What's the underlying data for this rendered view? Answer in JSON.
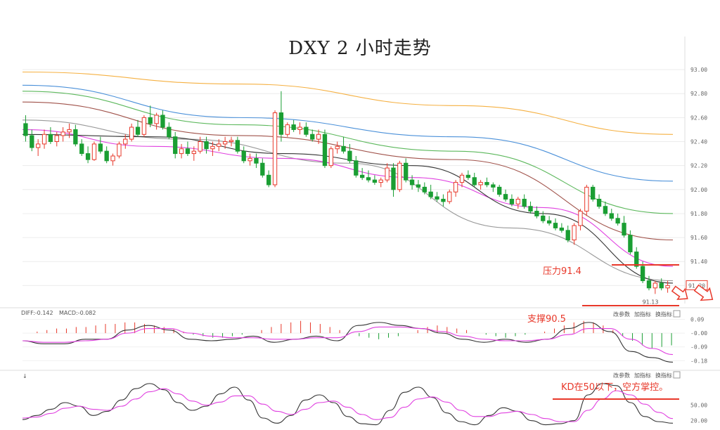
{
  "title": "DXY 2 小时走势",
  "annotations": {
    "resistance": "压力91.4",
    "support": "支撑90.5",
    "kd_note": "KD在50以下，空方掌控。"
  },
  "main_panel": {
    "price_axis_ticks": [
      "93.00",
      "92.80",
      "92.60",
      "92.40",
      "92.20",
      "92.00",
      "91.80",
      "91.60",
      "91.40",
      "91.20"
    ],
    "low_label": "91.13",
    "current_label": "91.20"
  },
  "macd_panel": {
    "header": [
      "DIFF:-0.142",
      "MACD:-0.082"
    ],
    "buttons": [
      "改参数",
      "加指标",
      "换指标"
    ],
    "axis_ticks": [
      "0.09",
      "-0.00",
      "-0.09",
      "-0.18"
    ]
  },
  "kd_panel": {
    "buttons": [
      "改参数",
      "加指标",
      "换指标"
    ],
    "axis_ticks": [
      "50.00",
      "20.00"
    ]
  },
  "colors": {
    "up": "#e8382a",
    "down": "#1a9e33",
    "resistance_line": "#e8382a",
    "ma_orange": "#f5b041",
    "ma_blue": "#4a90d9",
    "ma_green": "#5cb85c",
    "ma_brown": "#a0524a",
    "ma_magenta": "#e040e0",
    "ma_gray": "#999999",
    "ma_black": "#333333"
  },
  "chart_data": {
    "type": "candlestick",
    "ylim": [
      91.05,
      93.1
    ],
    "levels": {
      "resistance": 91.4,
      "support": 90.5
    },
    "candles": [
      [
        92.55,
        92.62,
        92.4,
        92.45
      ],
      [
        92.45,
        92.5,
        92.32,
        92.35
      ],
      [
        92.35,
        92.42,
        92.28,
        92.38
      ],
      [
        92.38,
        92.5,
        92.34,
        92.46
      ],
      [
        92.46,
        92.52,
        92.38,
        92.4
      ],
      [
        92.4,
        92.48,
        92.36,
        92.45
      ],
      [
        92.45,
        92.52,
        92.4,
        92.48
      ],
      [
        92.48,
        92.55,
        92.43,
        92.5
      ],
      [
        92.5,
        92.54,
        92.36,
        92.38
      ],
      [
        92.38,
        92.42,
        92.28,
        92.3
      ],
      [
        92.3,
        92.36,
        92.22,
        92.25
      ],
      [
        92.25,
        92.4,
        92.24,
        92.38
      ],
      [
        92.38,
        92.44,
        92.3,
        92.32
      ],
      [
        92.32,
        92.36,
        92.22,
        92.24
      ],
      [
        92.24,
        92.3,
        92.2,
        92.28
      ],
      [
        92.28,
        92.4,
        92.26,
        92.38
      ],
      [
        92.38,
        92.46,
        92.34,
        92.42
      ],
      [
        92.42,
        92.55,
        92.4,
        92.52
      ],
      [
        92.52,
        92.58,
        92.44,
        92.46
      ],
      [
        92.46,
        92.62,
        92.44,
        92.6
      ],
      [
        92.6,
        92.7,
        92.52,
        92.55
      ],
      [
        92.55,
        92.64,
        92.5,
        92.62
      ],
      [
        92.62,
        92.66,
        92.5,
        92.52
      ],
      [
        92.52,
        92.56,
        92.42,
        92.44
      ],
      [
        92.44,
        92.48,
        92.26,
        92.3
      ],
      [
        92.3,
        92.38,
        92.26,
        92.34
      ],
      [
        92.34,
        92.4,
        92.28,
        92.3
      ],
      [
        92.3,
        92.36,
        92.24,
        92.32
      ],
      [
        92.32,
        92.44,
        92.3,
        92.4
      ],
      [
        92.4,
        92.44,
        92.3,
        92.34
      ],
      [
        92.34,
        92.4,
        92.28,
        92.36
      ],
      [
        92.36,
        92.42,
        92.32,
        92.38
      ],
      [
        92.38,
        92.44,
        92.34,
        92.4
      ],
      [
        92.4,
        92.44,
        92.36,
        92.41
      ],
      [
        92.41,
        92.44,
        92.3,
        92.32
      ],
      [
        92.32,
        92.36,
        92.22,
        92.24
      ],
      [
        92.24,
        92.3,
        92.2,
        92.26
      ],
      [
        92.26,
        92.3,
        92.18,
        92.22
      ],
      [
        92.22,
        92.26,
        92.1,
        92.12
      ],
      [
        92.12,
        92.16,
        92.02,
        92.04
      ],
      [
        92.04,
        92.66,
        92.02,
        92.64
      ],
      [
        92.64,
        92.82,
        92.4,
        92.46
      ],
      [
        92.46,
        92.56,
        92.44,
        92.54
      ],
      [
        92.54,
        92.58,
        92.48,
        92.5
      ],
      [
        92.5,
        92.56,
        92.46,
        92.52
      ],
      [
        92.52,
        92.56,
        92.44,
        92.46
      ],
      [
        92.46,
        92.5,
        92.4,
        92.42
      ],
      [
        92.42,
        92.5,
        92.38,
        92.46
      ],
      [
        92.46,
        92.5,
        92.18,
        92.2
      ],
      [
        92.2,
        92.36,
        92.18,
        92.34
      ],
      [
        92.34,
        92.4,
        92.3,
        92.36
      ],
      [
        92.36,
        92.44,
        92.3,
        92.32
      ],
      [
        92.32,
        92.38,
        92.22,
        92.24
      ],
      [
        92.24,
        92.28,
        92.1,
        92.12
      ],
      [
        92.12,
        92.18,
        92.08,
        92.1
      ],
      [
        92.1,
        92.16,
        92.06,
        92.08
      ],
      [
        92.08,
        92.12,
        92.04,
        92.06
      ],
      [
        92.06,
        92.1,
        92.02,
        92.08
      ],
      [
        92.08,
        92.22,
        92.06,
        92.18
      ],
      [
        92.18,
        92.22,
        91.94,
        92.0
      ],
      [
        92.0,
        92.24,
        91.98,
        92.22
      ],
      [
        92.22,
        92.26,
        92.06,
        92.08
      ],
      [
        92.08,
        92.12,
        92.0,
        92.04
      ],
      [
        92.04,
        92.08,
        91.98,
        92.02
      ],
      [
        92.02,
        92.06,
        91.96,
        91.98
      ],
      [
        91.98,
        92.04,
        91.92,
        91.94
      ],
      [
        91.94,
        91.98,
        91.9,
        91.92
      ],
      [
        91.92,
        91.96,
        91.86,
        91.9
      ],
      [
        91.9,
        92.0,
        91.88,
        91.98
      ],
      [
        91.98,
        92.08,
        91.94,
        92.06
      ],
      [
        92.06,
        92.14,
        92.02,
        92.12
      ],
      [
        92.12,
        92.16,
        92.08,
        92.1
      ],
      [
        92.1,
        92.14,
        92.02,
        92.04
      ],
      [
        92.04,
        92.08,
        92.0,
        92.06
      ],
      [
        92.06,
        92.1,
        92.02,
        92.04
      ],
      [
        92.04,
        92.06,
        91.98,
        92.02
      ],
      [
        92.02,
        92.04,
        91.94,
        91.96
      ],
      [
        91.96,
        92.0,
        91.9,
        91.92
      ],
      [
        91.92,
        91.96,
        91.86,
        91.88
      ],
      [
        91.88,
        91.94,
        91.84,
        91.92
      ],
      [
        91.92,
        91.96,
        91.84,
        91.86
      ],
      [
        91.86,
        91.9,
        91.8,
        91.82
      ],
      [
        91.82,
        91.86,
        91.76,
        91.78
      ],
      [
        91.78,
        91.82,
        91.72,
        91.74
      ],
      [
        91.74,
        91.78,
        91.7,
        91.72
      ],
      [
        91.72,
        91.76,
        91.66,
        91.68
      ],
      [
        91.68,
        91.72,
        91.64,
        91.66
      ],
      [
        91.66,
        91.7,
        91.56,
        91.58
      ],
      [
        91.58,
        91.72,
        91.54,
        91.7
      ],
      [
        91.7,
        91.84,
        91.66,
        91.82
      ],
      [
        91.82,
        92.04,
        91.78,
        92.02
      ],
      [
        92.02,
        92.04,
        91.9,
        91.92
      ],
      [
        91.92,
        91.96,
        91.84,
        91.86
      ],
      [
        91.86,
        91.9,
        91.78,
        91.8
      ],
      [
        91.8,
        91.84,
        91.74,
        91.76
      ],
      [
        91.76,
        91.8,
        91.7,
        91.72
      ],
      [
        91.72,
        91.78,
        91.6,
        91.62
      ],
      [
        91.62,
        91.66,
        91.46,
        91.48
      ],
      [
        91.48,
        91.52,
        91.34,
        91.36
      ],
      [
        91.36,
        91.4,
        91.22,
        91.24
      ],
      [
        91.24,
        91.28,
        91.16,
        91.18
      ],
      [
        91.18,
        91.24,
        91.13,
        91.22
      ],
      [
        91.22,
        91.26,
        91.16,
        91.18
      ],
      [
        91.18,
        91.24,
        91.14,
        91.2
      ]
    ],
    "moving_averages": [
      {
        "color_key": "ma_orange",
        "values": [
          92.98,
          92.88,
          92.7,
          92.46
        ]
      },
      {
        "color_key": "ma_blue",
        "values": [
          92.87,
          92.6,
          92.44,
          92.07
        ]
      },
      {
        "color_key": "ma_green",
        "values": [
          92.82,
          92.54,
          92.32,
          91.8
        ]
      },
      {
        "color_key": "ma_brown",
        "values": [
          92.73,
          92.45,
          92.25,
          91.58
        ]
      },
      {
        "color_key": "ma_gray",
        "values": [
          92.58,
          92.42,
          92.22,
          91.68,
          91.24
        ]
      },
      {
        "color_key": "ma_magenta",
        "values": [
          92.5,
          92.36,
          92.26,
          92.1,
          91.85,
          91.36
        ]
      },
      {
        "color_key": "ma_black",
        "values": [
          92.46,
          92.44,
          92.3,
          92.2,
          91.8,
          91.22
        ]
      }
    ],
    "macd": {
      "ylim": [
        -0.22,
        0.12
      ],
      "hist": [
        0.0,
        0.01,
        0.02,
        0.03,
        0.03,
        0.04,
        0.04,
        0.05,
        0.06,
        0.06,
        0.07,
        0.07,
        0.06,
        0.05,
        0.04,
        0.03,
        0.01,
        -0.01,
        -0.02,
        -0.03,
        -0.03,
        -0.02,
        -0.01,
        0.0,
        0.02,
        0.04,
        0.06,
        0.07,
        0.08,
        0.07,
        0.06,
        0.04,
        0.02,
        0.0,
        -0.02,
        -0.03,
        -0.04,
        -0.03,
        -0.02,
        0.0,
        0.02,
        0.04,
        0.05,
        0.04,
        0.03,
        0.02,
        0.0,
        -0.01,
        -0.02,
        -0.03,
        -0.02,
        -0.01,
        0.0,
        0.01,
        0.03,
        0.05,
        0.07,
        0.08,
        0.07,
        0.05,
        0.02,
        -0.02,
        -0.05,
        -0.08,
        -0.1,
        -0.09,
        -0.08
      ],
      "diff": [
        -0.05,
        -0.07,
        -0.07,
        -0.04,
        -0.04,
        0.02,
        0.05,
        0.02,
        -0.04,
        -0.05,
        -0.04,
        -0.02,
        -0.06,
        -0.04,
        -0.02,
        -0.05,
        0.05,
        0.07,
        0.05,
        0.03,
        0.0,
        -0.04,
        -0.06,
        -0.04,
        -0.06,
        -0.04,
        0.03,
        0.07,
        0.01,
        -0.12,
        -0.16,
        -0.19
      ],
      "dea": [
        -0.05,
        -0.06,
        -0.06,
        -0.05,
        -0.04,
        0.0,
        0.03,
        0.03,
        0.0,
        -0.02,
        -0.03,
        -0.03,
        -0.04,
        -0.04,
        -0.03,
        -0.03,
        0.01,
        0.04,
        0.04,
        0.03,
        0.01,
        -0.02,
        -0.04,
        -0.05,
        -0.05,
        -0.04,
        -0.01,
        0.03,
        0.03,
        -0.04,
        -0.1,
        -0.14
      ]
    },
    "kd": {
      "ylim": [
        10,
        100
      ],
      "k": [
        22,
        30,
        42,
        55,
        48,
        30,
        38,
        60,
        82,
        92,
        80,
        55,
        40,
        48,
        72,
        85,
        60,
        25,
        15,
        30,
        60,
        70,
        55,
        28,
        14,
        12,
        40,
        75,
        85,
        65,
        35,
        18,
        12,
        30,
        45,
        38,
        20,
        12,
        14,
        20,
        70,
        92,
        88,
        55,
        28,
        18,
        15
      ],
      "d": [
        25,
        27,
        34,
        44,
        48,
        42,
        40,
        48,
        62,
        76,
        82,
        72,
        58,
        50,
        56,
        68,
        68,
        52,
        38,
        32,
        42,
        55,
        58,
        46,
        32,
        22,
        26,
        46,
        62,
        66,
        56,
        40,
        28,
        28,
        35,
        38,
        32,
        24,
        18,
        18,
        40,
        62,
        78,
        70,
        52,
        36,
        24
      ]
    }
  }
}
